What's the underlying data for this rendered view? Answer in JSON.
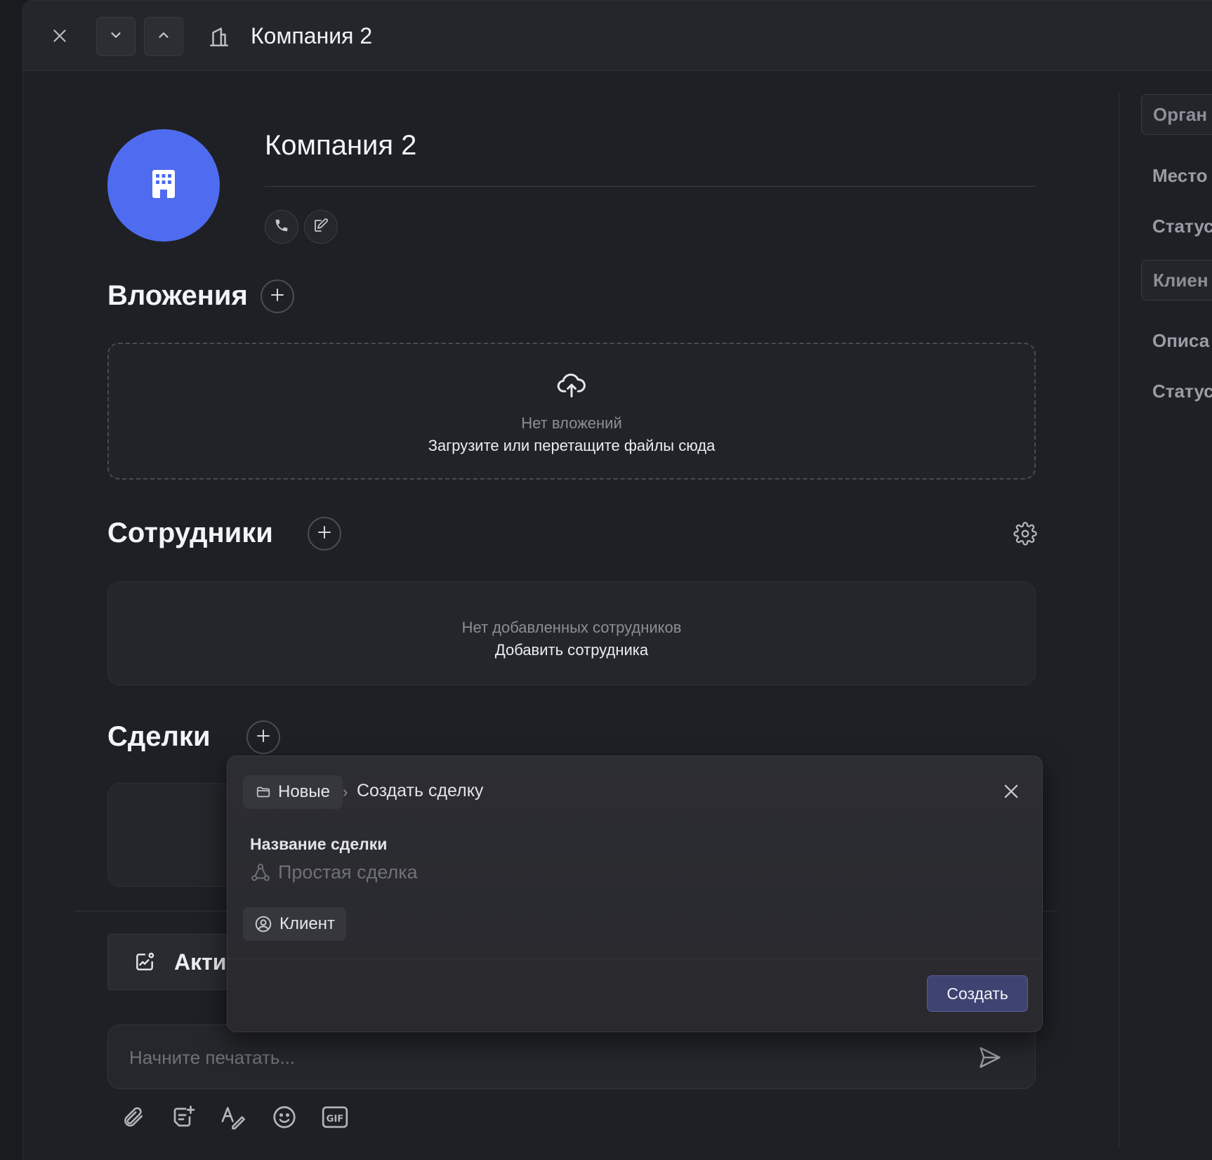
{
  "header": {
    "title": "Компания 2"
  },
  "company": {
    "name": "Компания 2"
  },
  "attachments": {
    "title": "Вложения",
    "empty_title": "Нет вложений",
    "empty_action": "Загрузите или перетащите файлы сюда"
  },
  "employees": {
    "title": "Сотрудники",
    "empty_title": "Нет добавленных сотрудников",
    "empty_action": "Добавить сотрудника"
  },
  "deals": {
    "title": "Сделки"
  },
  "activity": {
    "tab_label": "Акти"
  },
  "composer": {
    "placeholder": "Начните печатать..."
  },
  "sidebar": {
    "chips": [
      "Орган",
      "Клиен"
    ],
    "labels": [
      "Место",
      "Статус",
      "Описа",
      "Статус"
    ]
  },
  "deal_popup": {
    "pipeline_chip": "Новые",
    "breadcrumb_sep": "›",
    "breadcrumb": "Создать сделку",
    "name_label": "Название сделки",
    "name_placeholder": "Простая сделка",
    "client_chip": "Клиент",
    "create_label": "Создать"
  },
  "colors": {
    "avatar": "#4f6cf0",
    "primary_button": "#3e4371",
    "background": "#1f2025"
  },
  "icons": {
    "close": "close-icon",
    "down": "chevron-down-icon",
    "up": "chevron-up-icon",
    "building": "building-icon",
    "phone": "phone-icon",
    "edit": "edit-icon",
    "upload": "cloud-upload-icon",
    "settings": "gear-icon",
    "send": "send-icon"
  }
}
